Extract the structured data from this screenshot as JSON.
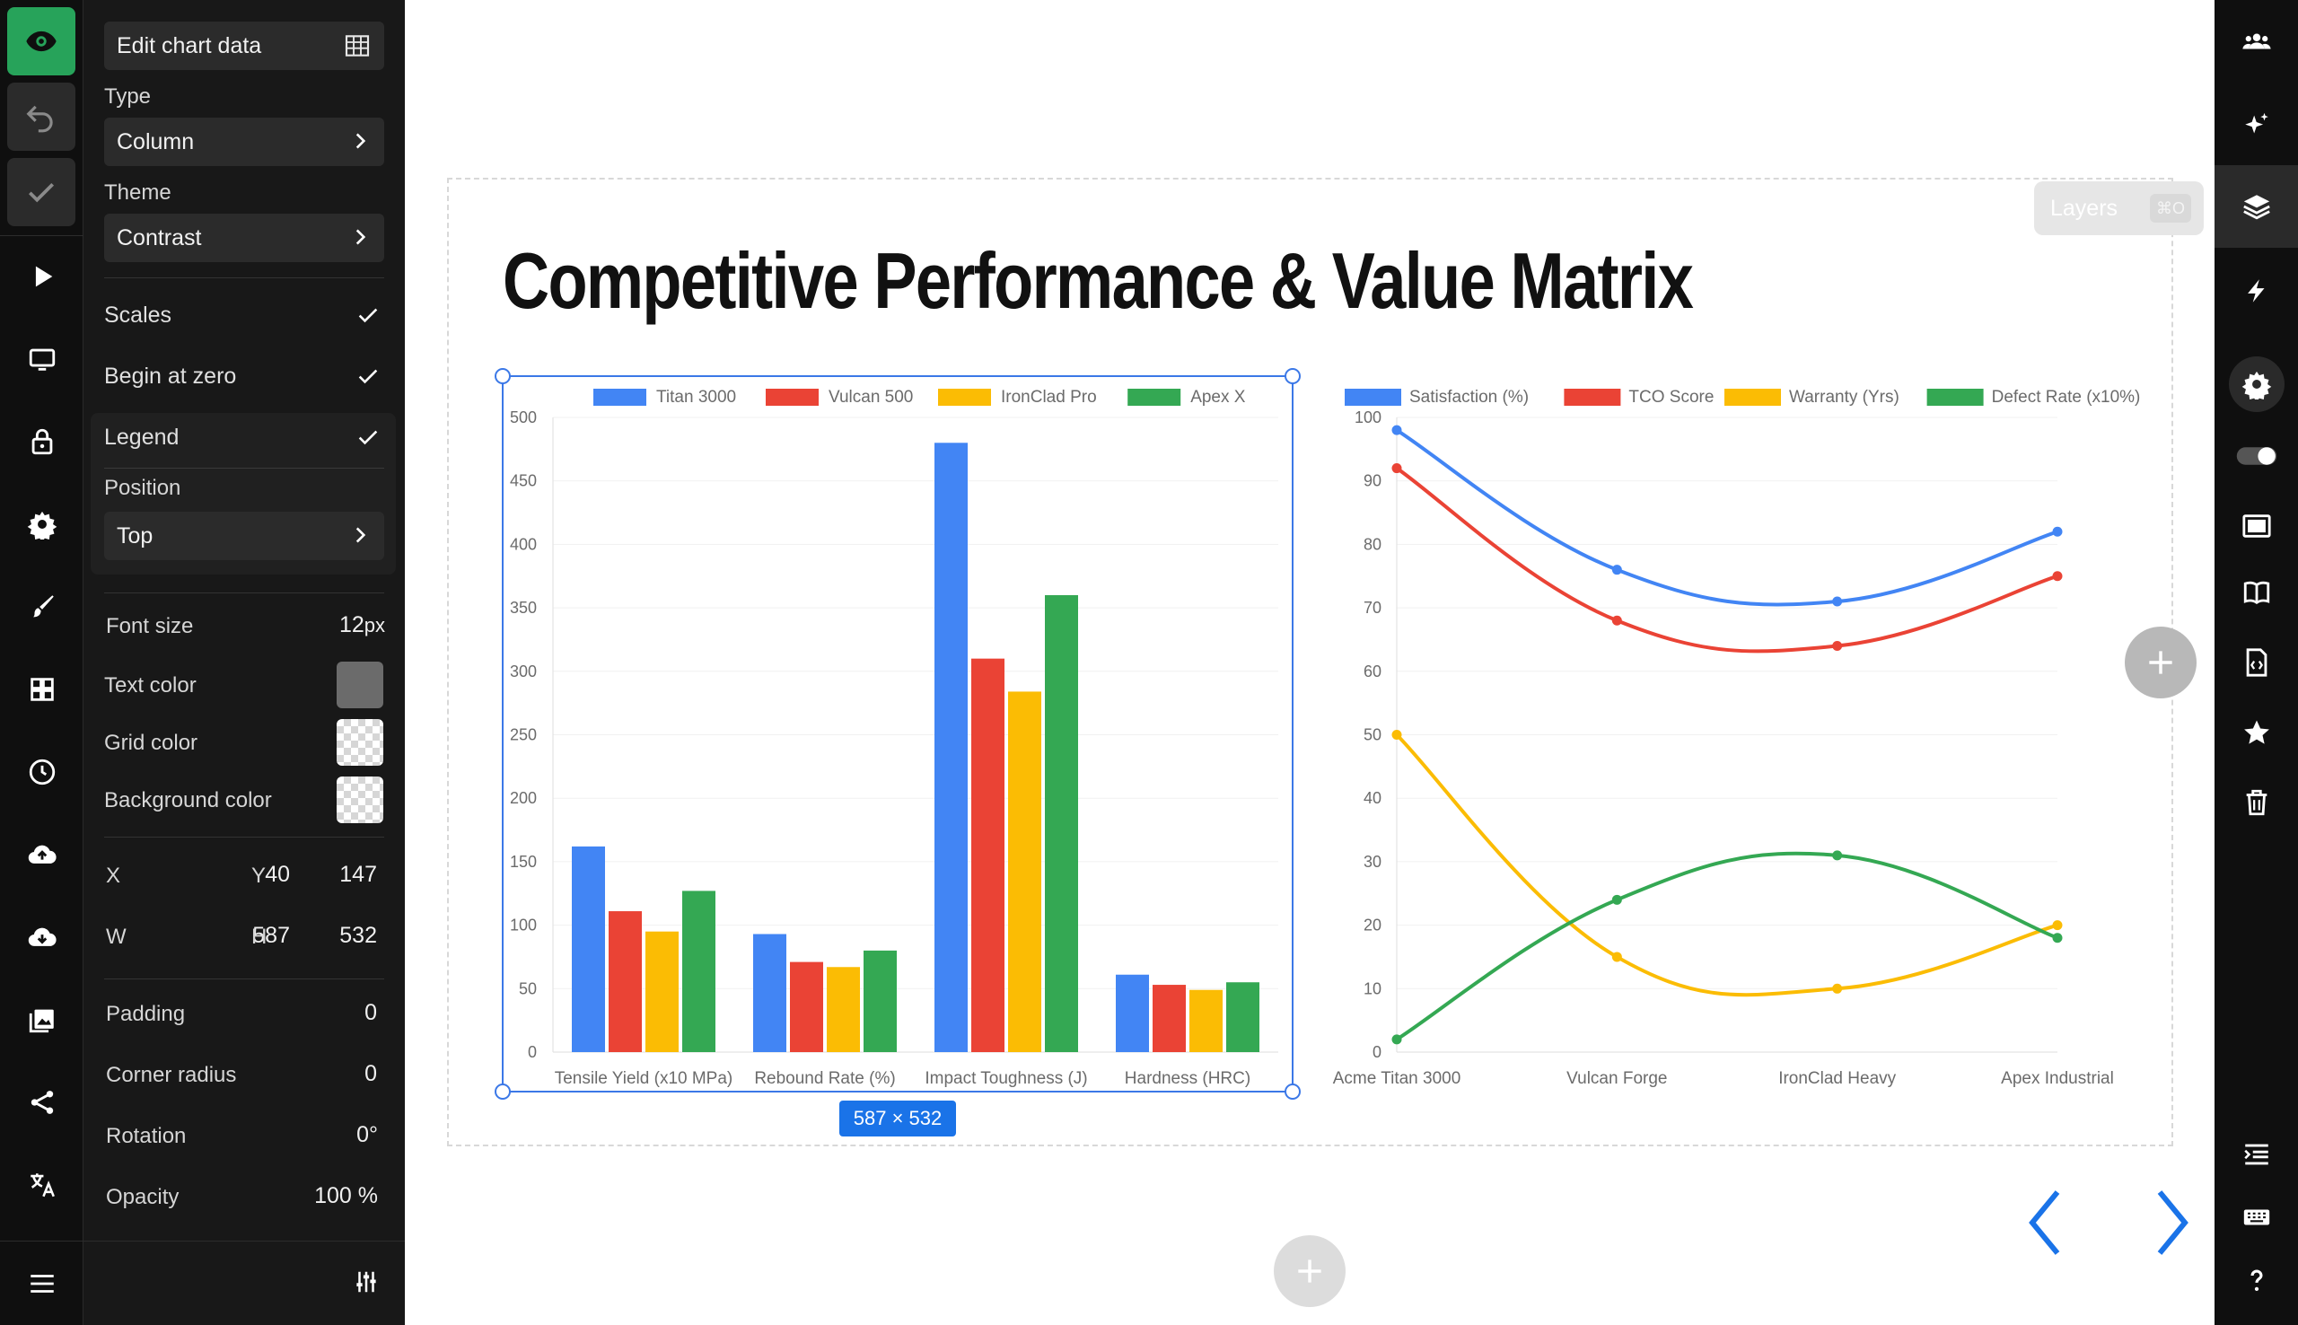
{
  "left_rail": {
    "icons": [
      "eye-icon",
      "undo-icon",
      "check-icon",
      "play-icon",
      "monitor-icon",
      "lock-icon",
      "gear-icon",
      "brush-icon",
      "grid-icon",
      "clock-icon",
      "cloud-upload-icon",
      "cloud-download-icon",
      "image-icon",
      "share-icon",
      "translate-icon",
      "menu-icon"
    ],
    "accent": "#27a35a"
  },
  "panel": {
    "edit_chart_data": "Edit chart data",
    "type_label": "Type",
    "type_value": "Column",
    "theme_label": "Theme",
    "theme_value": "Contrast",
    "scales": "Scales",
    "begin_at_zero": "Begin at zero",
    "legend": "Legend",
    "position_label": "Position",
    "position_value": "Top",
    "font_size_label": "Font size",
    "font_size_value": "12",
    "font_size_unit": "px",
    "text_color_label": "Text color",
    "text_color": "#6b6b6b",
    "grid_color_label": "Grid color",
    "background_color_label": "Background color",
    "x_label": "X",
    "x_value": "40",
    "y_label": "Y",
    "y_value": "147",
    "w_label": "W",
    "w_value": "587",
    "h_label": "H",
    "h_value": "532",
    "padding_label": "Padding",
    "padding_value": "0",
    "corner_radius_label": "Corner radius",
    "corner_radius_value": "0",
    "rotation_label": "Rotation",
    "rotation_value": "0°",
    "opacity_label": "Opacity",
    "opacity_value": "100 %"
  },
  "right_rail": {
    "icons": [
      "users-icon",
      "sparkle-icon",
      "layers-icon",
      "bolt-icon",
      "gear-icon",
      "toggle-icon",
      "slideshow-icon",
      "book-icon",
      "code-file-icon",
      "star-icon",
      "trash-icon",
      "indent-icon",
      "keyboard-icon",
      "help-icon"
    ]
  },
  "canvas": {
    "title": "Competitive Performance & Value Matrix",
    "layers_label": "Layers",
    "layers_shortcut": "⌘O",
    "size_badge": "587 × 532",
    "nav_color": "#1a73e8"
  },
  "chart_data": [
    {
      "type": "bar",
      "legend_position": "top",
      "categories": [
        "Tensile Yield (x10 MPa)",
        "Rebound Rate (%)",
        "Impact Toughness (J)",
        "Hardness (HRC)"
      ],
      "series": [
        {
          "name": "Titan 3000",
          "color": "#4285f4",
          "values": [
            162,
            93,
            480,
            61
          ]
        },
        {
          "name": "Vulcan 500",
          "color": "#ea4335",
          "values": [
            111,
            71,
            310,
            53
          ]
        },
        {
          "name": "IronClad Pro",
          "color": "#fbbc04",
          "values": [
            95,
            67,
            284,
            49
          ]
        },
        {
          "name": "Apex X",
          "color": "#34a853",
          "values": [
            127,
            80,
            360,
            55
          ]
        }
      ],
      "ylim": [
        0,
        500
      ],
      "yticks": [
        "0",
        "50",
        "100",
        "150",
        "200",
        "250",
        "300",
        "350",
        "400",
        "450",
        "500"
      ],
      "grid": true
    },
    {
      "type": "line",
      "legend_position": "top",
      "categories": [
        "Acme Titan 3000",
        "Vulcan Forge",
        "IronClad Heavy",
        "Apex Industrial"
      ],
      "series": [
        {
          "name": "Satisfaction (%)",
          "color": "#4285f4",
          "values": [
            98,
            76,
            71,
            82
          ]
        },
        {
          "name": "TCO Score",
          "color": "#ea4335",
          "values": [
            92,
            68,
            64,
            75
          ]
        },
        {
          "name": "Warranty (Yrs)",
          "color": "#fbbc04",
          "values": [
            50,
            15,
            10,
            20
          ]
        },
        {
          "name": "Defect Rate (x10%)",
          "color": "#34a853",
          "values": [
            2,
            24,
            31,
            18
          ]
        }
      ],
      "ylim": [
        0,
        100
      ],
      "yticks": [
        "0",
        "10",
        "20",
        "30",
        "40",
        "50",
        "60",
        "70",
        "80",
        "90",
        "100"
      ],
      "grid": true
    }
  ]
}
